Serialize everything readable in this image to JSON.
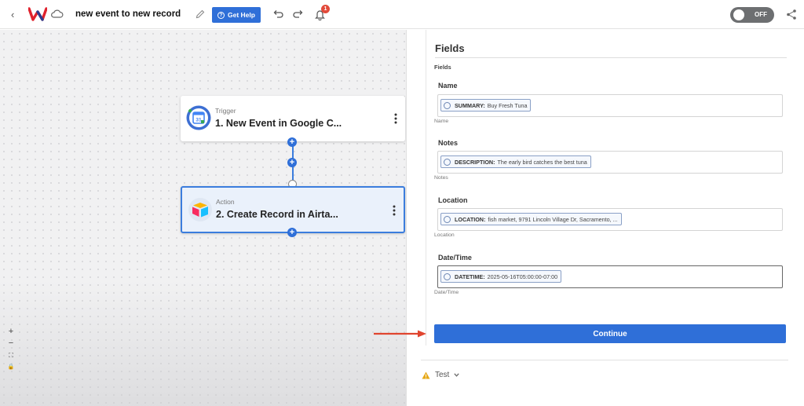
{
  "header": {
    "back_glyph": "‹",
    "title": "new event to new record",
    "help_label": "Get Help",
    "help_icon_glyph": "?",
    "notification_count": "1",
    "toggle_label": "OFF"
  },
  "canvas": {
    "nodes": [
      {
        "type": "Trigger",
        "title": "1. New Event in Google C..."
      },
      {
        "type": "Action",
        "title": "2. Create Record in Airta..."
      }
    ],
    "plus_glyph": "+",
    "zoom_controls": [
      "+",
      "−",
      "⛶",
      "🔒"
    ]
  },
  "panel": {
    "heading": "Fields",
    "caption": "Fields",
    "fields": [
      {
        "label": "Name",
        "chip_key": "SUMMARY:",
        "chip_value": "Buy Fresh Tuna",
        "hint": "Name"
      },
      {
        "label": "Notes",
        "chip_key": "DESCRIPTION:",
        "chip_value": "The early bird catches the best tuna",
        "hint": "Notes"
      },
      {
        "label": "Location",
        "chip_key": "LOCATION:",
        "chip_value": "fish market, 9791 Lincoln Village Dr, Sacramento, ...",
        "hint": "Location"
      },
      {
        "label": "Date/Time",
        "chip_key": "DATETIME:",
        "chip_value": "2025-05-16T05:00:00-07:00",
        "hint": "Date/Time"
      }
    ],
    "continue_label": "Continue",
    "test_label": "Test"
  },
  "colors": {
    "accent": "#2f6fd8",
    "arrow": "#e0452f",
    "badge": "#e24a3a"
  }
}
